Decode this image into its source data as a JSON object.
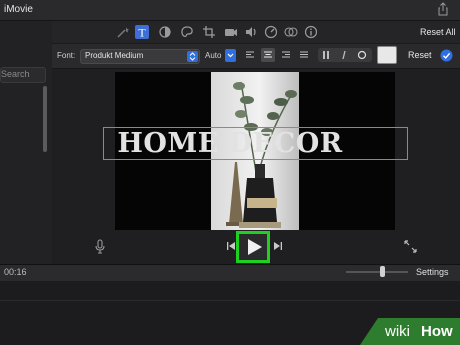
{
  "app": {
    "title": "iMovie"
  },
  "toolbar": {
    "icons": [
      "magic-wand-icon",
      "title-text-icon",
      "color-balance-icon",
      "palette-icon",
      "crop-icon",
      "camera-icon",
      "speaker-icon",
      "gauge-icon",
      "filter-icon",
      "info-icon"
    ],
    "reset_all_label": "Reset All"
  },
  "titlebar": {
    "share_icon": "share-icon"
  },
  "sidebar": {
    "search_text": "Search"
  },
  "fontbar": {
    "font_label": "Font:",
    "font_value": "Produkt Medium",
    "size_value": "Auto",
    "align_options": [
      "left",
      "center",
      "right",
      "justify"
    ],
    "style_options": [
      "B",
      "I",
      "O"
    ],
    "text_color": "#e8e8e8",
    "reset_label": "Reset",
    "apply_icon": "checkmark-icon"
  },
  "viewer": {
    "overlay_title": "HOME DECOR"
  },
  "controls": {
    "mic_icon": "microphone-icon",
    "prev_icon": "skip-back-icon",
    "play_icon": "play-icon",
    "next_icon": "skip-forward-icon",
    "fullscreen_icon": "fullscreen-icon",
    "highlight_color": "#20d020"
  },
  "timeline": {
    "timecode": "00:16",
    "settings_label": "Settings"
  },
  "watermark": {
    "wiki": "wiki",
    "how": "How"
  }
}
